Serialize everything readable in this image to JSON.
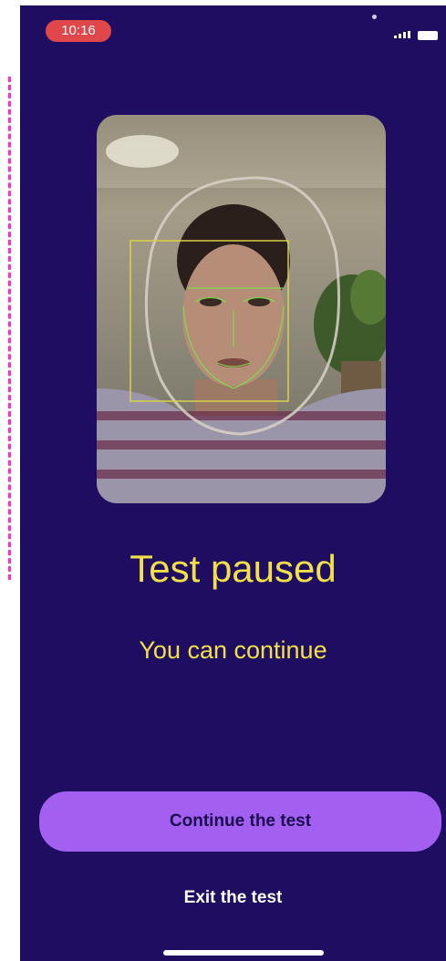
{
  "status_bar": {
    "time": "10:16",
    "signal_icon": "signal-icon",
    "battery_icon": "battery-icon"
  },
  "camera": {
    "overlay": "face-detection-overlay"
  },
  "main": {
    "title": "Test paused",
    "subtitle": "You can continue"
  },
  "actions": {
    "continue_label": "Continue the test",
    "exit_label": "Exit the test"
  },
  "colors": {
    "background": "#1f0d62",
    "accent_text": "#f2e04a",
    "button": "#a35ff0",
    "time_pill": "#e0474b"
  }
}
